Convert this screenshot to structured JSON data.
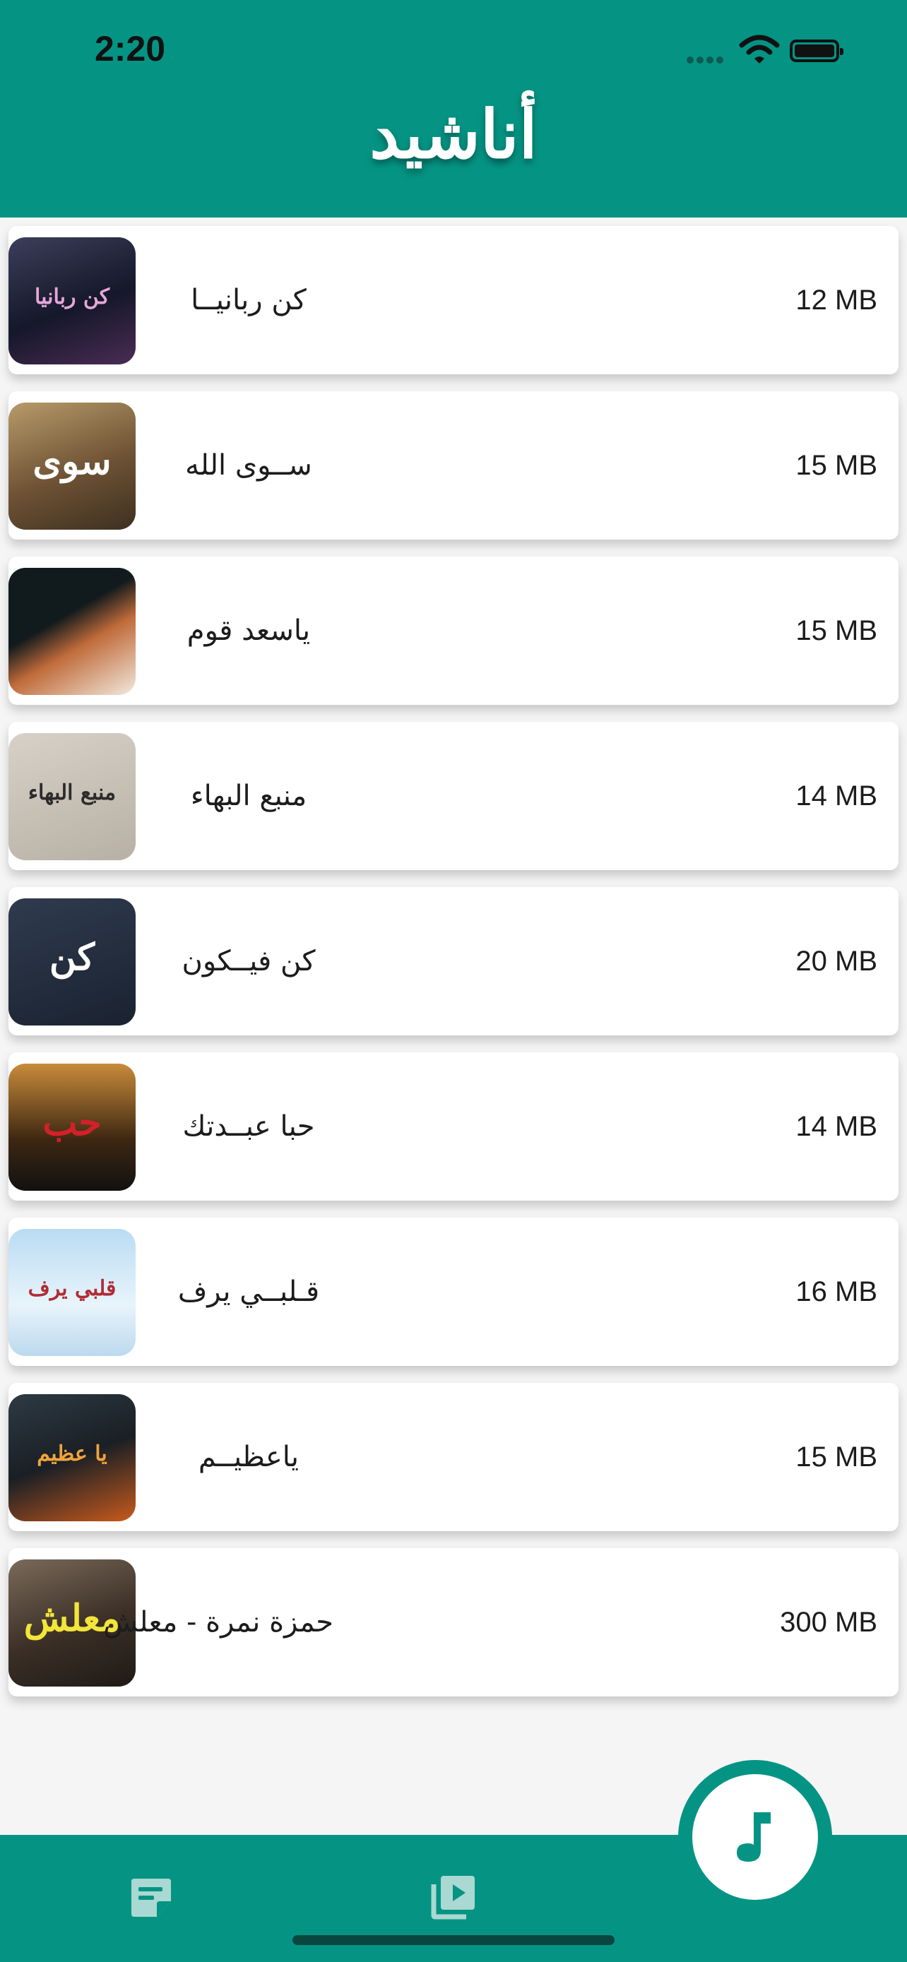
{
  "status_bar": {
    "time": "2:20"
  },
  "header": {
    "title": "أناشيد"
  },
  "tracks": [
    {
      "title": "كن ربانيــا",
      "size": "12 MB",
      "thumb_text": "كن ربانيا",
      "thumb_bg": "linear-gradient(160deg,#3c3f5a,#15172a 55%,#4a2c54)",
      "thumb_color": "#e6a7d9"
    },
    {
      "title": "ســوى الله",
      "size": "15 MB",
      "thumb_text": "سوى",
      "thumb_bg": "linear-gradient(160deg,#b79b6a,#6e5234 55%,#3d3020)",
      "thumb_color": "#ffffff"
    },
    {
      "title": "ياسعد قوم",
      "size": "15 MB",
      "thumb_text": "",
      "thumb_bg": "linear-gradient(150deg,#111a1c 40%,#c06b3a 60%,#f2e9de)",
      "thumb_color": "#ffffff"
    },
    {
      "title": "منبع البهاء",
      "size": "14 MB",
      "thumb_text": "منبع البهاء",
      "thumb_bg": "linear-gradient(160deg,#d7d1c8,#b8b0a4)",
      "thumb_color": "#2b2b2b"
    },
    {
      "title": "كن فيــكون",
      "size": "20 MB",
      "thumb_text": "كن",
      "thumb_bg": "linear-gradient(160deg,#2f3b4e,#1a2230)",
      "thumb_color": "#ffffff"
    },
    {
      "title": "حبا عبــدتك",
      "size": "14 MB",
      "thumb_text": "حب",
      "thumb_bg": "linear-gradient(180deg,#c98b3a,#3d2712 60%,#111)",
      "thumb_color": "#d3202a"
    },
    {
      "title": "قـلبــي يرف",
      "size": "16 MB",
      "thumb_text": "قلبي يرف",
      "thumb_bg": "linear-gradient(180deg,#b9dcf2,#e8f4fb 60%,#bcd9ee)",
      "thumb_color": "#b12b34"
    },
    {
      "title": "ياعظيــم",
      "size": "15 MB",
      "thumb_text": "يا عظيم",
      "thumb_bg": "linear-gradient(160deg,#2d3a44,#1a1f25 50%,#c85a1c)",
      "thumb_color": "#f0a43a"
    },
    {
      "title": "حمزة نمرة - معلش",
      "size": "300 MB",
      "thumb_text": "معلش",
      "thumb_bg": "linear-gradient(160deg,#7a6a5a,#3b2f26 55%,#1f1a16)",
      "thumb_color": "#f3e53a"
    }
  ],
  "bottom_nav": {
    "items": [
      {
        "icon": "notes-icon"
      },
      {
        "icon": "video-library-icon"
      },
      {
        "icon": "music-note-icon",
        "active": true
      }
    ]
  },
  "colors": {
    "primary": "#059484",
    "card": "#ffffff",
    "background": "#f5f5f5"
  }
}
